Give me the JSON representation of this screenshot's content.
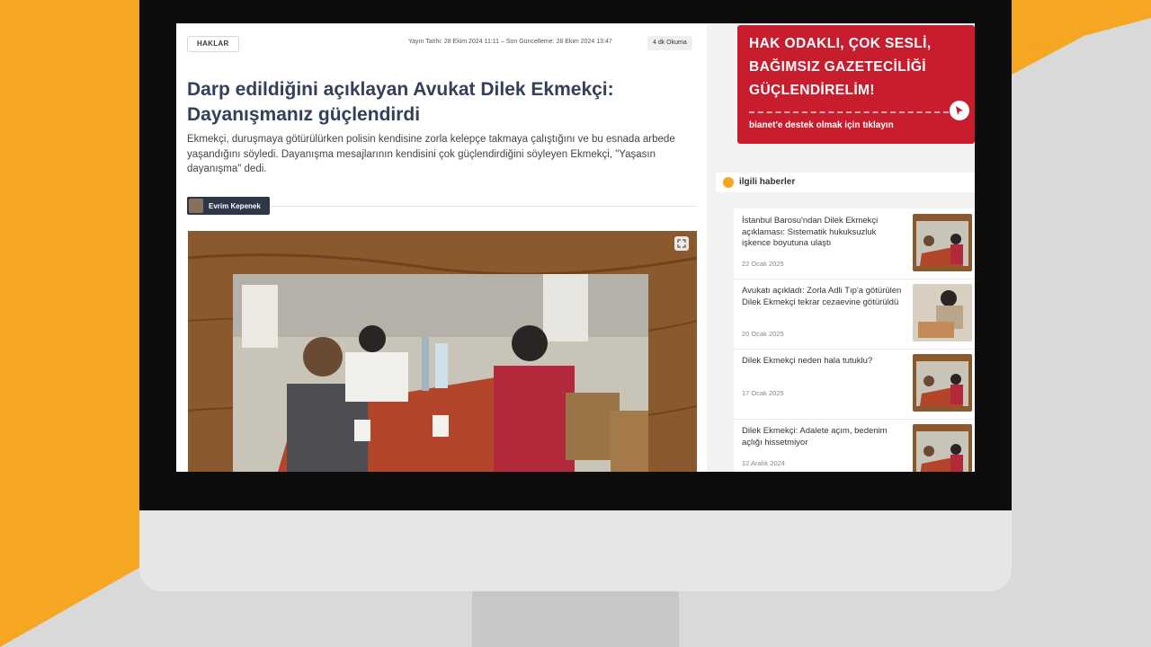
{
  "article": {
    "category": "HAKLAR",
    "meta": "Yayın Tarihi: 28 Ekim 2024 11:11 – Son Güncelleme: 28 Ekim 2024 13:47",
    "read_time": "4 dk Okuma",
    "title": "Darp edildiğini açıklayan Avukat Dilek Ekmekçi: Dayanışmanız güçlendirdi",
    "lead": "Ekmekçi, duruşmaya götürülürken polisin kendisine zorla kelepçe takmaya çalıştığını ve bu esnada arbede yaşandığını söyledi. Dayanışma mesajlarının kendisini çok güçlendirdiğini söyleyen Ekmekçi, \"Yaşasın dayanışma\" dedi.",
    "author": "Evrim Kepenek"
  },
  "promo": {
    "line1": "HAK ODAKLI, ÇOK SESLİ,",
    "line2": "BAĞIMSIZ GAZETECİLİĞİ",
    "line3": "GÜÇLENDİRELİM!",
    "cta": "bianet'e destek olmak için tıklayın"
  },
  "related": {
    "title": "ilgili haberler",
    "items": [
      {
        "title": "İstanbul Barosu'ndan Dilek Ekmekçi açıklaması: Sistematik hukuksuzluk işkence boyutuna ulaştı",
        "date": "22 Ocak 2025"
      },
      {
        "title": "Avukatı açıkladı: Zorla Adli Tıp'a götürülen Dilek Ekmekçi tekrar cezaevine götürüldü",
        "date": "20 Ocak 2025"
      },
      {
        "title": "Dilek Ekmekçi neden hala tutuklu?",
        "date": "17 Ocak 2025"
      },
      {
        "title": "Dilek Ekmekçi: Adalete açım, bedenim açlığı hissetmiyor",
        "date": "12 Aralık 2024"
      }
    ]
  },
  "colors": {
    "background_orange": "#f5a623",
    "promo_red": "#c81d2c",
    "title_navy": "#33405a"
  }
}
